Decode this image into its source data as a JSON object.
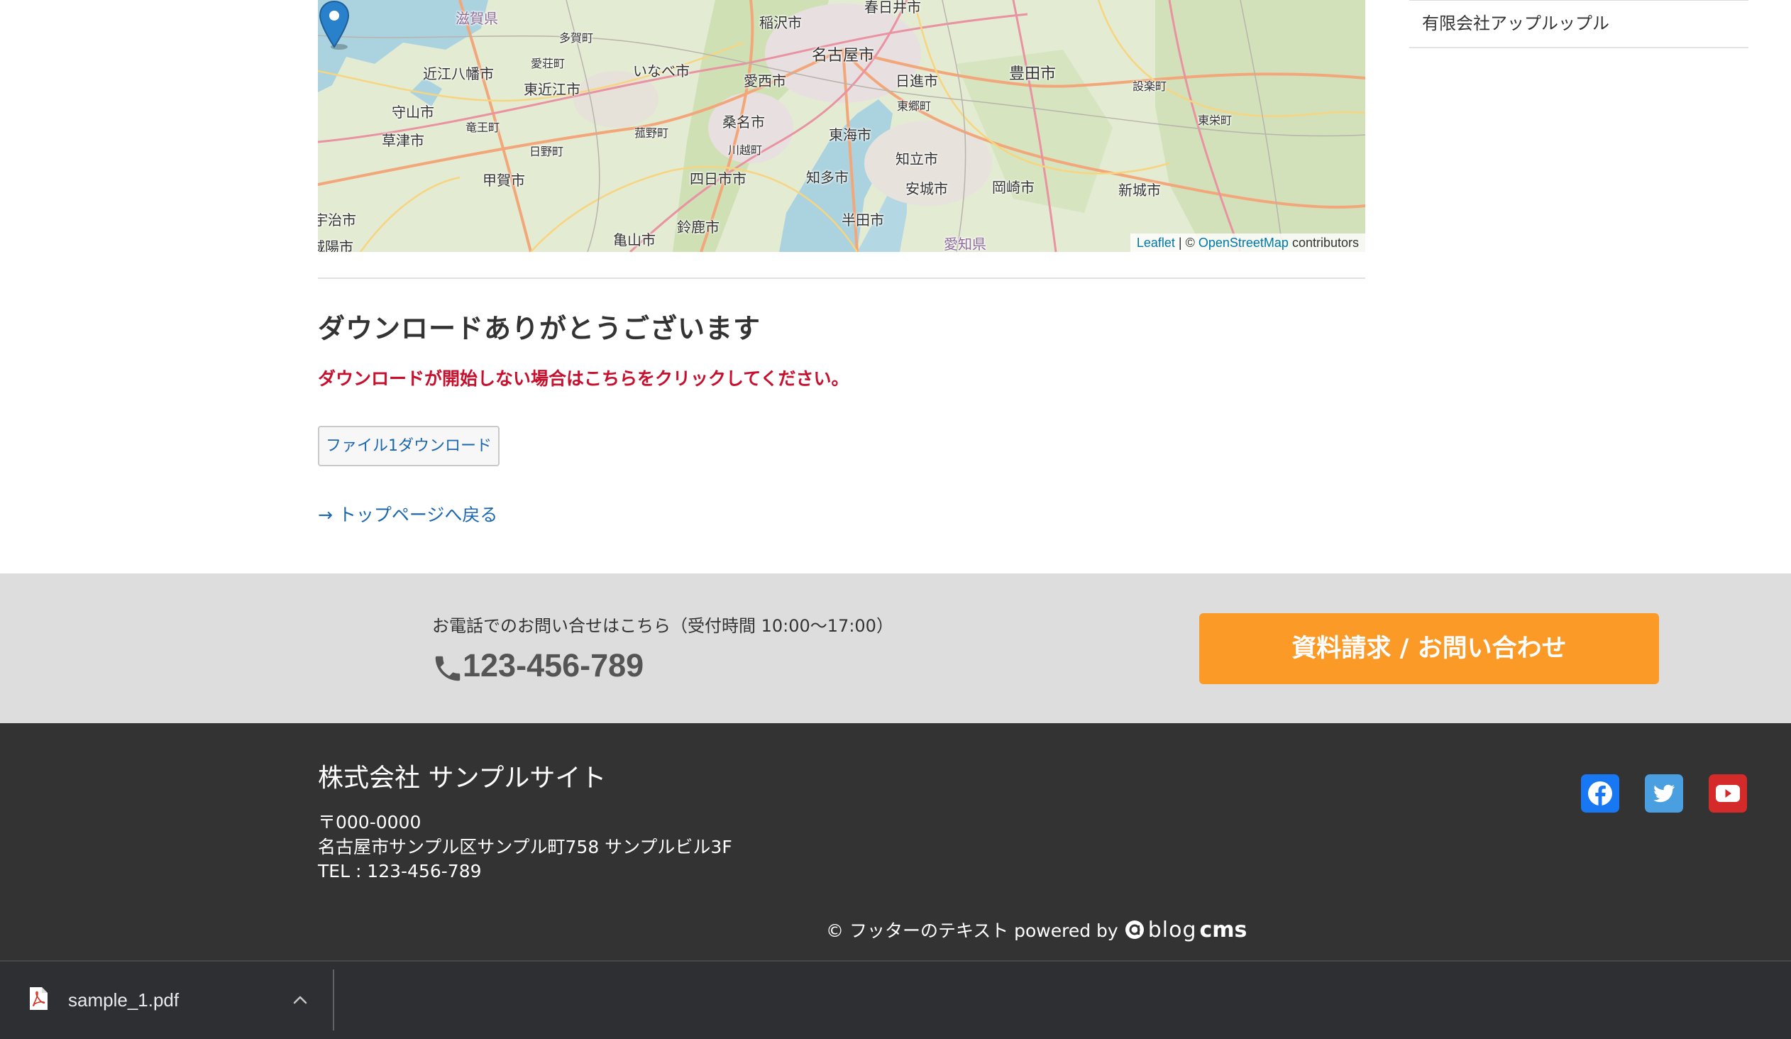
{
  "map": {
    "labels": [
      {
        "text": "滋賀県",
        "cls": "pref"
      },
      {
        "text": "稲沢市",
        "cls": ""
      },
      {
        "text": "春日井市",
        "cls": ""
      },
      {
        "text": "多賀町",
        "cls": "small"
      },
      {
        "text": "愛荘町",
        "cls": "small"
      },
      {
        "text": "近江八幡市",
        "cls": ""
      },
      {
        "text": "東近江市",
        "cls": ""
      },
      {
        "text": "いなべ市",
        "cls": ""
      },
      {
        "text": "名古屋市",
        "cls": "big"
      },
      {
        "text": "愛西市",
        "cls": ""
      },
      {
        "text": "日進市",
        "cls": ""
      },
      {
        "text": "豊田市",
        "cls": "big"
      },
      {
        "text": "設楽町",
        "cls": "small"
      },
      {
        "text": "東郷町",
        "cls": "small"
      },
      {
        "text": "守山市",
        "cls": ""
      },
      {
        "text": "竜王町",
        "cls": "small"
      },
      {
        "text": "菰野町",
        "cls": "small"
      },
      {
        "text": "桑名市",
        "cls": ""
      },
      {
        "text": "東栄町",
        "cls": "small"
      },
      {
        "text": "東海市",
        "cls": ""
      },
      {
        "text": "草津市",
        "cls": ""
      },
      {
        "text": "日野町",
        "cls": "small"
      },
      {
        "text": "川越町",
        "cls": "small"
      },
      {
        "text": "知立市",
        "cls": ""
      },
      {
        "text": "甲賀市",
        "cls": ""
      },
      {
        "text": "四日市市",
        "cls": ""
      },
      {
        "text": "知多市",
        "cls": ""
      },
      {
        "text": "安城市",
        "cls": ""
      },
      {
        "text": "岡崎市",
        "cls": ""
      },
      {
        "text": "新城市",
        "cls": ""
      },
      {
        "text": "宇治市",
        "cls": ""
      },
      {
        "text": "半田市",
        "cls": ""
      },
      {
        "text": "鈴鹿市",
        "cls": ""
      },
      {
        "text": "亀山市",
        "cls": ""
      },
      {
        "text": "愛知県",
        "cls": "pref"
      },
      {
        "text": "城陽市",
        "cls": ""
      }
    ],
    "attribution_leaflet": "Leaflet",
    "attribution_sep": " | © ",
    "attribution_osm": "OpenStreetMap",
    "attribution_suffix": " contributors"
  },
  "sidebar": {
    "item_label": "有限会社アップルップル"
  },
  "main": {
    "heading": "ダウンロードありがとうございます",
    "notice": "ダウンロードが開始しない場合はこちらをクリックしてください。",
    "download_button": "ファイル1ダウンロード",
    "back_link": "→ トップページへ戻る"
  },
  "contact": {
    "note": "お電話でのお問い合せはこちら（受付時間 10:00〜17:00）",
    "phone": "123-456-789",
    "cta": "資料請求 / お問い合わせ"
  },
  "footer": {
    "company": "株式会社 サンプルサイト",
    "postal": "〒000-0000",
    "address": "名古屋市サンプル区サンプル町758 サンプルビル3F",
    "tel": "TEL : 123-456-789",
    "copyright": "© フッターのテキスト powered by",
    "logo_blog": "blog",
    "logo_cms": "cms",
    "social": [
      {
        "name": "facebook-icon",
        "color": "#1877f2"
      },
      {
        "name": "twitter-icon",
        "color": "#4a9fe0"
      },
      {
        "name": "youtube-icon",
        "color": "#d52a2a"
      }
    ]
  },
  "download_bar": {
    "filename": "sample_1.pdf"
  },
  "colors": {
    "accent_orange": "#fc9a28",
    "notice_red": "#c7102e",
    "link_blue": "#1b66b1",
    "footer_bg": "#333333",
    "contact_bg": "#dddddd"
  }
}
